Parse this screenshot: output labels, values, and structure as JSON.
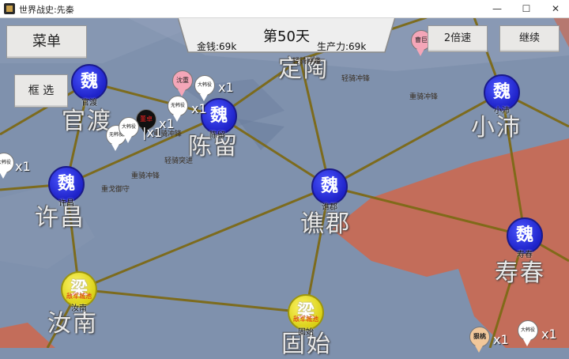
{
  "window": {
    "title": "世界战史:先秦",
    "min": "—",
    "max": "☐",
    "close": "✕"
  },
  "hud": {
    "menu": "菜单",
    "select": "框 选",
    "speed": "2倍速",
    "resume": "继续",
    "day": "第50天",
    "money": "金钱:69k",
    "production": "生产力:69k"
  },
  "colors": {
    "wei": "#1e22c8",
    "liang": "#d9d016",
    "enemy_territory": "#c96a52",
    "road": "#7d6a16"
  },
  "regions": {
    "guandu": "官渡",
    "chenliu": "陈留",
    "dingtao": "定陶",
    "xiaopei": "小沛",
    "xuchang": "许昌",
    "qiaojun": "谯郡",
    "runan": "汝南",
    "shouchun": "寿春",
    "gushi": "固始"
  },
  "cities": {
    "guandu": {
      "glyph": "魏",
      "name": "官渡"
    },
    "chenliu": {
      "glyph": "魏",
      "name": "陈留"
    },
    "xiaopei": {
      "glyph": "魏",
      "name": "小沛"
    },
    "xuchang": {
      "glyph": "魏",
      "name": "许昌"
    },
    "qiaojun": {
      "glyph": "魏",
      "name": "谯郡"
    },
    "shouchun": {
      "glyph": "魏",
      "name": "寿春"
    },
    "runan": {
      "glyph": "梁",
      "name": "汝南",
      "tag": "敌军城池"
    },
    "gushi": {
      "glyph": "梁",
      "name": "固始",
      "tag": "敌军城池"
    }
  },
  "units": {
    "u1": {
      "label": "沈重",
      "count": "x1"
    },
    "u2": {
      "label": "大韩役",
      "count": "x1"
    },
    "u3": {
      "label": "无韩役",
      "count": "x1"
    },
    "u4": {
      "label": "董卓",
      "count": "x1"
    },
    "u5": {
      "label": "无韩役",
      "count": ""
    },
    "u6": {
      "label": "大韩役",
      "count": ""
    },
    "u7": {
      "label": "大韩役",
      "count": "x1"
    },
    "u8": {
      "label": "曹巨",
      "count": ""
    },
    "u9": {
      "label": "狠桃",
      "count": "x1"
    },
    "u10": {
      "label": "大韩役",
      "count": "x1"
    }
  },
  "troops": [
    "轻骑冲锋",
    "重骑冲锋",
    "轻骑突进",
    "重骑冲锋",
    "重戈御守",
    "重骑冲锋",
    "轻骑冲锋"
  ]
}
